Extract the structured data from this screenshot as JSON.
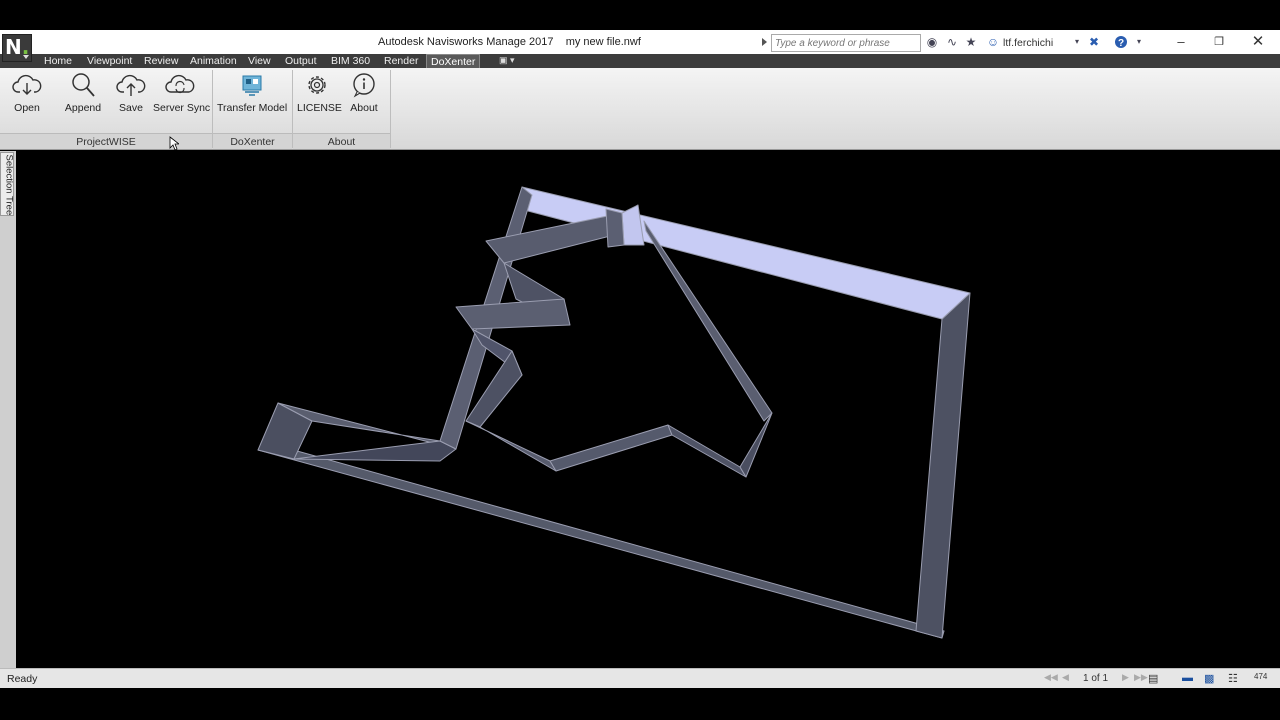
{
  "window": {
    "title": "Autodesk Navisworks Manage 2017    my new file.nwf",
    "search_placeholder": "Type a keyword or phrase",
    "user": "ltf.ferchichi"
  },
  "tabs": [
    {
      "label": "Home"
    },
    {
      "label": "Viewpoint"
    },
    {
      "label": "Review"
    },
    {
      "label": "Animation"
    },
    {
      "label": "View"
    },
    {
      "label": "Output"
    },
    {
      "label": "BIM 360"
    },
    {
      "label": "Render"
    },
    {
      "label": "DoXenter",
      "active": true
    }
  ],
  "ribbon": {
    "buttons": {
      "open": "Open",
      "append": "Append",
      "save": "Save",
      "server_sync": "Server Sync",
      "transfer_model": "Transfer Model",
      "license": "LICENSE",
      "about": "About"
    },
    "groups": {
      "projectwise": "ProjectWISE",
      "doxenter": "DoXenter",
      "about": "About"
    }
  },
  "side_panel": {
    "tab_label": "Selection Tree"
  },
  "status": {
    "text": "Ready",
    "page_indicator": "1 of 1",
    "memory": "474"
  },
  "colors": {
    "viewport_bg": "#000000",
    "wall_face": "#4a4e5e",
    "wall_lit": "#c8ccf5",
    "ribbon_bg": "#e6e6e6"
  }
}
